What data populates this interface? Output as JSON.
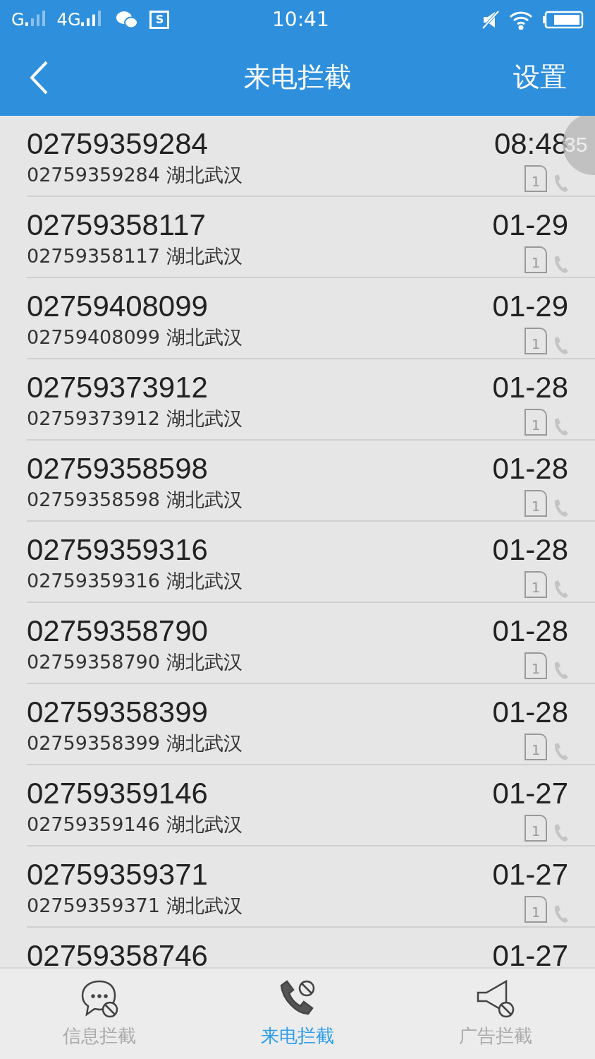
{
  "status_bar": {
    "network_1": "G",
    "network_2": "4G",
    "notification_glyph": "S",
    "time": "10:41"
  },
  "header": {
    "title": "来电拦截",
    "action": "设置"
  },
  "floating_badge": {
    "text": "35"
  },
  "calls": [
    {
      "number": "02759359284",
      "detail": "02759359284 湖北武汉",
      "time": "08:48",
      "sim": "1"
    },
    {
      "number": "02759358117",
      "detail": "02759358117 湖北武汉",
      "time": "01-29",
      "sim": "1"
    },
    {
      "number": "02759408099",
      "detail": "02759408099 湖北武汉",
      "time": "01-29",
      "sim": "1"
    },
    {
      "number": "02759373912",
      "detail": "02759373912 湖北武汉",
      "time": "01-28",
      "sim": "1"
    },
    {
      "number": "02759358598",
      "detail": "02759358598 湖北武汉",
      "time": "01-28",
      "sim": "1"
    },
    {
      "number": "02759359316",
      "detail": "02759359316 湖北武汉",
      "time": "01-28",
      "sim": "1"
    },
    {
      "number": "02759358790",
      "detail": "02759358790 湖北武汉",
      "time": "01-28",
      "sim": "1"
    },
    {
      "number": "02759358399",
      "detail": "02759358399 湖北武汉",
      "time": "01-28",
      "sim": "1"
    },
    {
      "number": "02759359146",
      "detail": "02759359146 湖北武汉",
      "time": "01-27",
      "sim": "1"
    },
    {
      "number": "02759359371",
      "detail": "02759359371 湖北武汉",
      "time": "01-27",
      "sim": "1"
    },
    {
      "number": "02759358746",
      "time": "01-27"
    }
  ],
  "tabs": [
    {
      "kind": "message",
      "label": "信息拦截",
      "selected": false
    },
    {
      "kind": "call",
      "label": "来电拦截",
      "selected": true
    },
    {
      "kind": "ad",
      "label": "广告拦截",
      "selected": false
    }
  ]
}
